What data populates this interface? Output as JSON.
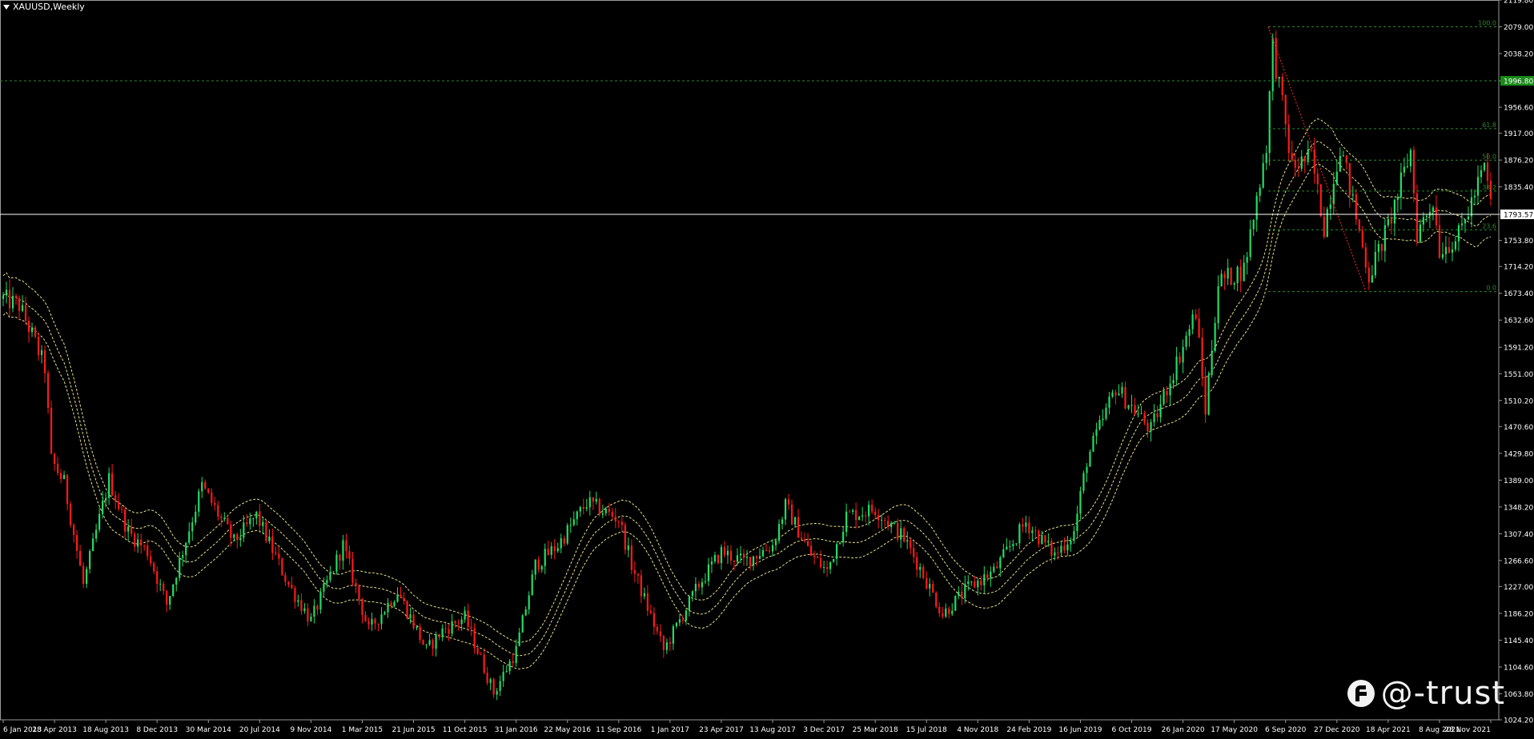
{
  "header": {
    "symbol_label": "XAUUSD,Weekly"
  },
  "watermark": {
    "text": "@-trust"
  },
  "colors": {
    "up": "#22dd66",
    "down": "#ff1a1a",
    "grid": "#1f6f1f",
    "fib": "#2a8a2a",
    "band": "#e8e08a",
    "price_line": "#ffffff",
    "axis_text": "#ffffff"
  },
  "chart_data": {
    "type": "candlestick",
    "title": "XAUUSD,Weekly",
    "ylim": [
      1024.2,
      2119.8
    ],
    "y_ticks": [
      "2119.80",
      "2079.00",
      "2038.20",
      "1996.80",
      "1956.60",
      "1917.00",
      "1876.20",
      "1835.40",
      "1793.57",
      "1753.80",
      "1714.20",
      "1673.40",
      "1632.60",
      "1591.20",
      "1551.00",
      "1510.20",
      "1470.60",
      "1429.80",
      "1389.00",
      "1348.20",
      "1307.40",
      "1266.60",
      "1227.00",
      "1186.20",
      "1145.40",
      "1104.60",
      "1063.80",
      "1024.20"
    ],
    "x_ticks": [
      "6 Jan 2013",
      "28 Apr 2013",
      "18 Aug 2013",
      "8 Dec 2013",
      "30 Mar 2014",
      "20 Jul 2014",
      "9 Nov 2014",
      "1 Mar 2015",
      "21 Jun 2015",
      "11 Oct 2015",
      "31 Jan 2016",
      "22 May 2016",
      "11 Sep 2016",
      "1 Jan 2017",
      "23 Apr 2017",
      "13 Aug 2017",
      "3 Dec 2017",
      "25 Mar 2018",
      "15 Jul 2018",
      "4 Nov 2018",
      "24 Feb 2019",
      "16 Jun 2019",
      "6 Oct 2019",
      "26 Jan 2020",
      "17 May 2020",
      "6 Sep 2020",
      "27 Dec 2020",
      "18 Apr 2021",
      "8 Aug 2021",
      "28 Nov 2021"
    ],
    "current_price": "1793.57",
    "highlight_level": "1996.80",
    "fib_levels": [
      {
        "label": "100.0",
        "value": 2079.0
      },
      {
        "label": "61.8",
        "value": 1924.0
      },
      {
        "label": "50.0",
        "value": 1876.0
      },
      {
        "label": "38.2",
        "value": 1829.0
      },
      {
        "label": "23.6",
        "value": 1770.0
      },
      {
        "label": "0.0",
        "value": 1676.0
      }
    ],
    "price_path": [
      [
        "2013-01-06",
        1665
      ],
      [
        "2013-02-10",
        1655
      ],
      [
        "2013-03-10",
        1610
      ],
      [
        "2013-04-07",
        1560
      ],
      [
        "2013-04-21",
        1420
      ],
      [
        "2013-05-19",
        1385
      ],
      [
        "2013-06-30",
        1230
      ],
      [
        "2013-08-25",
        1390
      ],
      [
        "2013-10-06",
        1310
      ],
      [
        "2013-11-17",
        1280
      ],
      [
        "2013-12-29",
        1200
      ],
      [
        "2014-03-16",
        1380
      ],
      [
        "2014-05-25",
        1295
      ],
      [
        "2014-07-13",
        1335
      ],
      [
        "2014-09-21",
        1230
      ],
      [
        "2014-11-09",
        1175
      ],
      [
        "2015-01-18",
        1290
      ],
      [
        "2015-03-15",
        1160
      ],
      [
        "2015-05-17",
        1220
      ],
      [
        "2015-07-19",
        1130
      ],
      [
        "2015-08-23",
        1160
      ],
      [
        "2015-10-11",
        1180
      ],
      [
        "2015-12-13",
        1065
      ],
      [
        "2016-01-31",
        1130
      ],
      [
        "2016-03-13",
        1260
      ],
      [
        "2016-05-01",
        1290
      ],
      [
        "2016-07-03",
        1355
      ],
      [
        "2016-09-11",
        1330
      ],
      [
        "2016-10-09",
        1260
      ],
      [
        "2016-12-18",
        1130
      ],
      [
        "2017-03-05",
        1230
      ],
      [
        "2017-04-23",
        1280
      ],
      [
        "2017-06-11",
        1265
      ],
      [
        "2017-08-13",
        1290
      ],
      [
        "2017-09-10",
        1350
      ],
      [
        "2017-11-05",
        1275
      ],
      [
        "2017-12-10",
        1250
      ],
      [
        "2018-01-21",
        1335
      ],
      [
        "2018-03-25",
        1345
      ],
      [
        "2018-05-27",
        1300
      ],
      [
        "2018-07-01",
        1255
      ],
      [
        "2018-08-19",
        1185
      ],
      [
        "2018-10-14",
        1225
      ],
      [
        "2018-12-09",
        1250
      ],
      [
        "2019-02-17",
        1325
      ],
      [
        "2019-04-21",
        1275
      ],
      [
        "2019-06-02",
        1310
      ],
      [
        "2019-06-30",
        1420
      ],
      [
        "2019-09-01",
        1530
      ],
      [
        "2019-10-13",
        1495
      ],
      [
        "2019-11-17",
        1465
      ],
      [
        "2020-01-05",
        1555
      ],
      [
        "2020-02-23",
        1645
      ],
      [
        "2020-03-15",
        1495
      ],
      [
        "2020-04-12",
        1690
      ],
      [
        "2020-06-07",
        1710
      ],
      [
        "2020-07-26",
        1900
      ],
      [
        "2020-08-09",
        2050
      ],
      [
        "2020-09-20",
        1865
      ],
      [
        "2020-11-01",
        1880
      ],
      [
        "2020-11-29",
        1775
      ],
      [
        "2021-01-03",
        1900
      ],
      [
        "2021-03-07",
        1700
      ],
      [
        "2021-04-18",
        1775
      ],
      [
        "2021-06-06",
        1890
      ],
      [
        "2021-06-20",
        1765
      ],
      [
        "2021-07-25",
        1815
      ],
      [
        "2021-08-08",
        1740
      ],
      [
        "2021-09-19",
        1760
      ],
      [
        "2021-11-14",
        1865
      ],
      [
        "2021-12-05",
        1783
      ]
    ]
  }
}
